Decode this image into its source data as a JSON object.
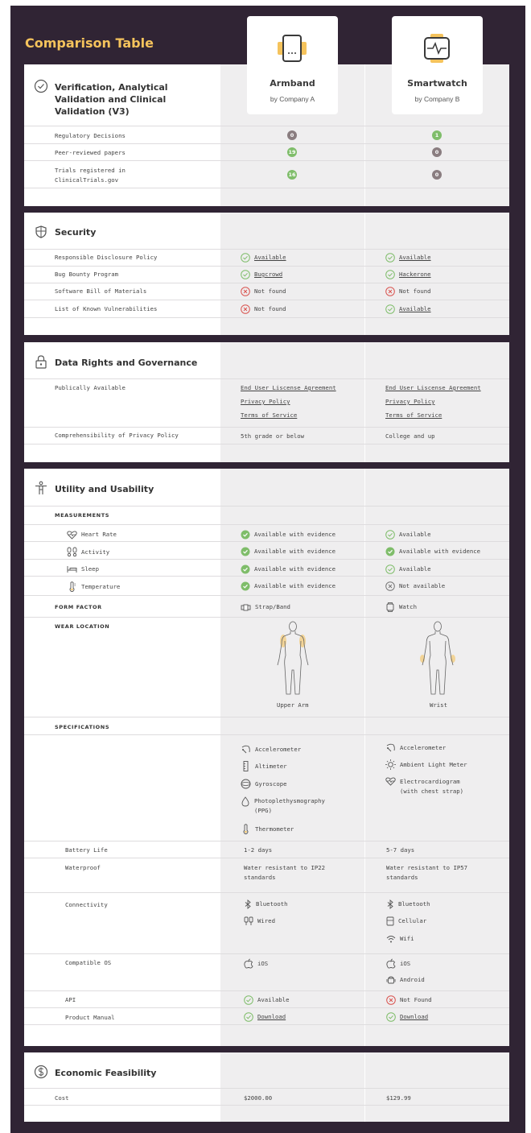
{
  "page_title": "Comparison Table",
  "colors": {
    "background": "#302434",
    "title": "#f5c35c",
    "accent_icon": "#f5c35c",
    "check": "#7fbd6a",
    "cross": "#d9534f"
  },
  "products": [
    {
      "name": "Armband",
      "by": "by Company A",
      "icon": "armband-icon"
    },
    {
      "name": "Smartwatch",
      "by": "by Company B",
      "icon": "smartwatch-icon"
    }
  ],
  "verification": {
    "title": "Verification, Analytical Validation and Clinical Validation (V3)",
    "title_lines": [
      "Verification, Analytical",
      "Validation and Clinical",
      "Validation (V3)"
    ],
    "rows": [
      {
        "label": "Regulatory Decisions",
        "a": "0",
        "b": "1"
      },
      {
        "label": "Peer-reviewed papers",
        "a": "19",
        "b": "0"
      },
      {
        "label": "Trials registered in ClinicalTrials.gov",
        "label_lines": [
          "Trials registered in",
          "ClinicalTrials.gov"
        ],
        "a": "16",
        "b": "0"
      }
    ]
  },
  "security": {
    "title": "Security",
    "rows": [
      {
        "label": "Responsible Disclosure Policy",
        "a": "Available",
        "b": "Available"
      },
      {
        "label": "Bug Bounty Program",
        "a": "Bugcrowd",
        "b": "Hackerone"
      },
      {
        "label": "Software Bill of Materials",
        "a": "Not found",
        "b": "Not found"
      },
      {
        "label": "List of Known Vulnerabilities",
        "a": "Not found",
        "b": "Available"
      }
    ]
  },
  "data_rights": {
    "title": "Data Rights and Governance",
    "publically_label": "Publically Available",
    "docs": [
      "End User Liscense Agreement",
      "Privacy Policy",
      "Terms of Service"
    ],
    "comprehensibility_label": "Comprehensibility of Privacy Policy",
    "comprehensibility_a": "5th grade or below",
    "comprehensibility_b": "College and up"
  },
  "utility": {
    "title": "Utility and Usability",
    "measurements_caption": "MEASUREMENTS",
    "measurements": [
      {
        "label": "Heart Rate",
        "icon": "heart-rate-icon",
        "a": "Available with evidence",
        "b": "Available"
      },
      {
        "label": "Activity",
        "icon": "footprints-icon",
        "a": "Available with evidence",
        "b": "Available with evidence"
      },
      {
        "label": "Sleep",
        "icon": "bed-icon",
        "a": "Available with evidence",
        "b": "Available"
      },
      {
        "label": "Temperature",
        "icon": "thermometer-icon",
        "a": "Available with evidence",
        "b": "Not available"
      }
    ],
    "form_factor_caption": "FORM FACTOR",
    "form_factor_a": "Strap/Band",
    "form_factor_b": "Watch",
    "wear_location_caption": "WEAR LOCATION",
    "wear_location_a": "Upper Arm",
    "wear_location_b": "Wrist",
    "specifications_caption": "SPECIFICATIONS",
    "sensors_a": [
      {
        "label": "Accelerometer",
        "icon": "accelerometer-icon"
      },
      {
        "label": "Altimeter",
        "icon": "altimeter-icon"
      },
      {
        "label": "Gyroscope",
        "icon": "gyroscope-icon"
      },
      {
        "label": "Photoplethysmography",
        "label2": "(PPG)",
        "icon": "drop-icon"
      },
      {
        "label": "Thermometer",
        "icon": "thermometer-icon"
      }
    ],
    "sensors_b": [
      {
        "label": "Accelerometer",
        "icon": "accelerometer-icon"
      },
      {
        "label": "Ambient Light Meter",
        "icon": "sun-icon"
      },
      {
        "label": "Electrocardiogram",
        "label2": "(with chest strap)",
        "icon": "heart-rate-icon"
      }
    ],
    "battery_label": "Battery Life",
    "battery_a": "1-2 days",
    "battery_b": "5-7 days",
    "waterproof_label": "Waterproof",
    "waterproof_a": "Water resistant to IP22 standards",
    "waterproof_a_lines": [
      "Water resistant to IP22",
      "standards"
    ],
    "waterproof_b": "Water resistant to IP57 standards",
    "waterproof_b_lines": [
      "Water resistant to IP57",
      "standards"
    ],
    "connectivity_label": "Connectivity",
    "connectivity_a": [
      "Bluetooth",
      "Wired"
    ],
    "connectivity_b": [
      "Bluetooth",
      "Cellular",
      "Wifi"
    ],
    "os_label": "Compatible OS",
    "os_a": [
      "iOS"
    ],
    "os_b": [
      "iOS",
      "Android"
    ],
    "api_label": "API",
    "api_a": "Available",
    "api_b": "Not Found",
    "manual_label": "Product Manual",
    "manual_a": "Download",
    "manual_b": "Download"
  },
  "economic": {
    "title": "Economic Feasibility",
    "cost_label": "Cost",
    "cost_a": "$2000.00",
    "cost_b": "$129.99"
  }
}
